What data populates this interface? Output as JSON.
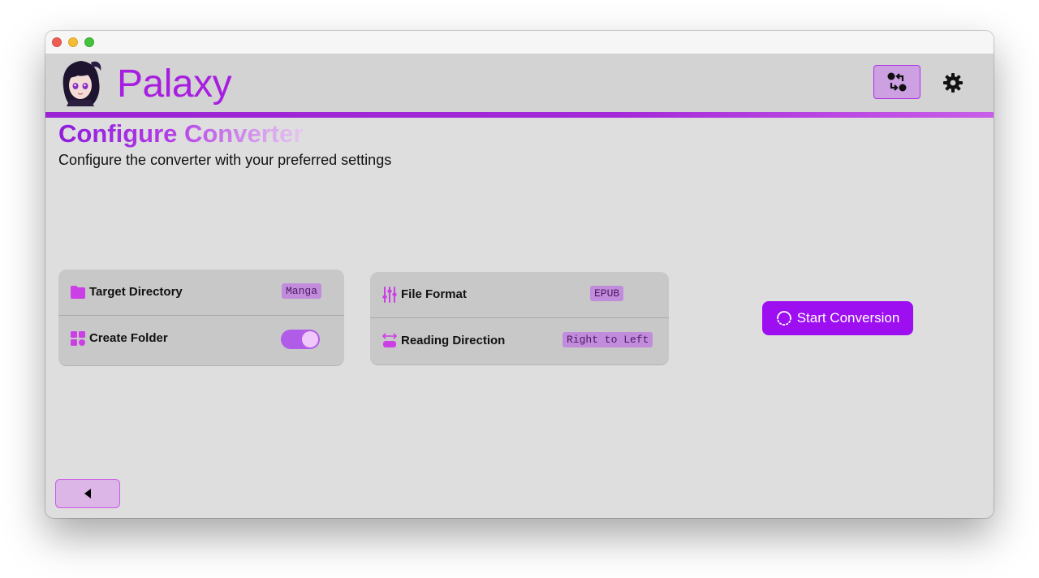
{
  "app": {
    "name": "Palaxy",
    "accent_color": "#9d0ff0"
  },
  "window_controls": {
    "close": "close-button",
    "minimize": "minimize-button",
    "zoom": "zoom-button"
  },
  "header": {
    "brand": "Palaxy",
    "avatar_icon": "anime-girl-avatar",
    "actions": [
      {
        "name": "swap-icon",
        "active": true
      },
      {
        "name": "gear-icon",
        "active": false
      }
    ]
  },
  "page": {
    "title": "Configure Converter",
    "subtitle": "Configure the converter with your preferred settings"
  },
  "settings_left": [
    {
      "label": "Target Directory",
      "value": "Manga",
      "icon": "folder-icon"
    },
    {
      "label": "Create Folder",
      "toggle": true,
      "icon": "grid-shapes-icon"
    }
  ],
  "settings_right": [
    {
      "label": "File Format",
      "value": "EPUB",
      "icon": "sliders-icon"
    },
    {
      "label": "Reading Direction",
      "value": "Right to Left",
      "icon": "direction-arrows-icon"
    }
  ],
  "actions": {
    "start_label": "Start Conversion",
    "start_icon": "spinner-icon",
    "back_icon": "triangle-left-icon"
  }
}
